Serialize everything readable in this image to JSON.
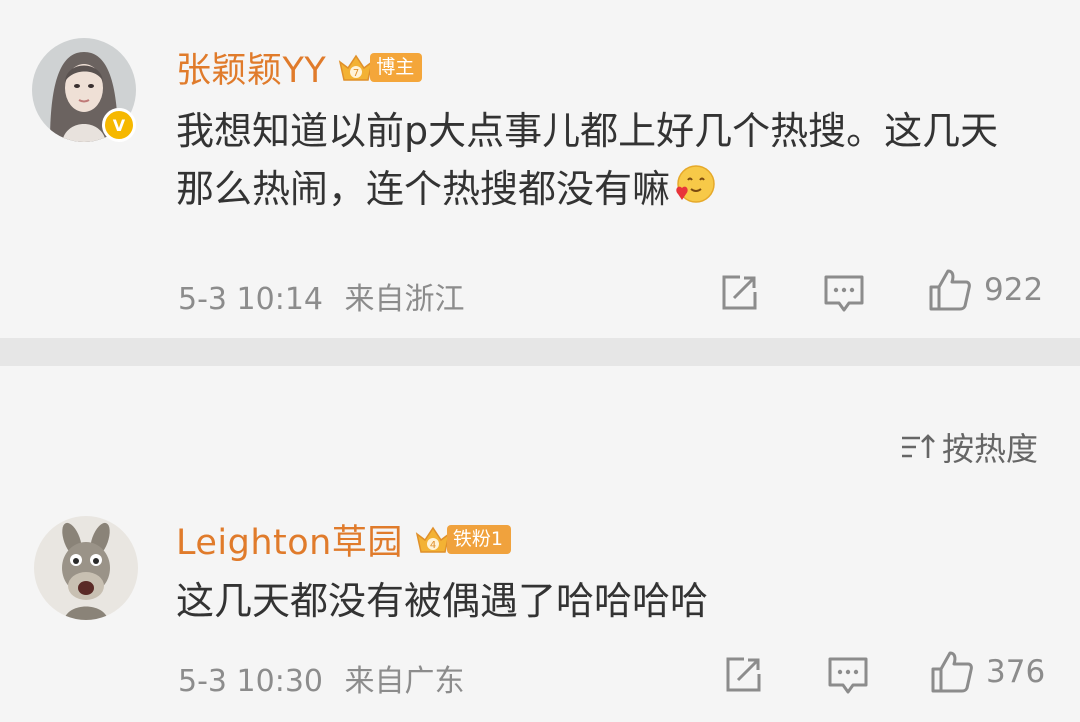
{
  "post": {
    "author": "张颖颖YY",
    "fan_tag": "博主",
    "fan_level": "7",
    "content_line1": "我想知道以前p大点事儿都上好几个热搜。这几天",
    "content_line2": "那么热闹，连个热搜都没有嘛",
    "emoji": "smile-heart-emoji",
    "timestamp": "5-3 10:14",
    "location": "来自浙江",
    "like_count": "922"
  },
  "sort": {
    "label": "按热度",
    "icon": "sort-icon"
  },
  "comment": {
    "author": "Leighton草园",
    "fan_tag": "铁粉1",
    "fan_level": "4",
    "content": "这几天都没有被偶遇了哈哈哈哈",
    "timestamp": "5-3 10:30",
    "location": "来自广东",
    "like_count": "376"
  },
  "colors": {
    "name": "#e07b2b",
    "tag_blogger": "#f4a63a",
    "tag_fan": "#f0a23d",
    "meta": "#8c8c8c",
    "text": "#333333",
    "verified": "#f6b800"
  }
}
